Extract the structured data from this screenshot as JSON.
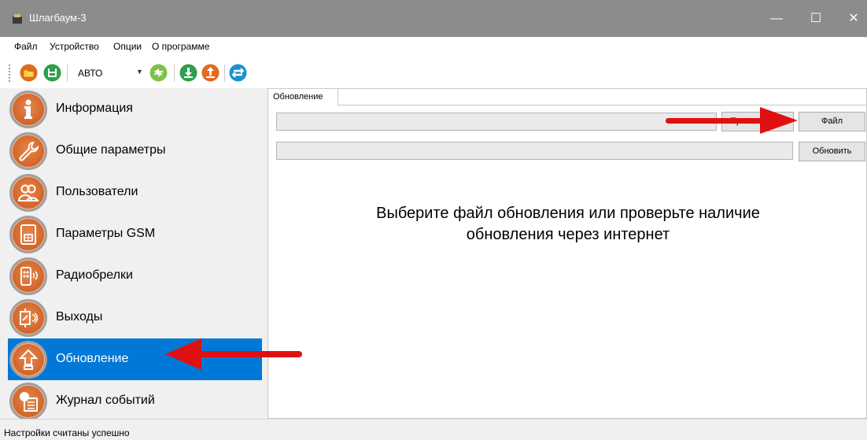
{
  "window": {
    "title": "Шлагбаум-3",
    "minimize": "—",
    "maximize": "☐",
    "close": "✕"
  },
  "menu": {
    "items": [
      "Файл",
      "Устройство",
      "Опции",
      "О программе"
    ]
  },
  "toolbar": {
    "mode_select": "АВТО",
    "buttons": [
      "open-folder-icon",
      "save-icon",
      "sync-icon",
      "download-icon",
      "upload-icon",
      "connection-icon"
    ]
  },
  "sidebar": {
    "items": [
      {
        "label": "Информация",
        "icon": "info-icon"
      },
      {
        "label": "Общие параметры",
        "icon": "wrench-icon"
      },
      {
        "label": "Пользователи",
        "icon": "users-icon"
      },
      {
        "label": "Параметры GSM",
        "icon": "sim-card-icon"
      },
      {
        "label": "Радиобрелки",
        "icon": "remote-fob-icon"
      },
      {
        "label": "Выходы",
        "icon": "relay-output-icon"
      },
      {
        "label": "Обновление",
        "icon": "update-arrow-icon",
        "active": true
      },
      {
        "label": "Журнал событий",
        "icon": "event-log-icon"
      }
    ]
  },
  "main": {
    "tab_label": "Обновление",
    "file_path_value": "",
    "update_path_value": "",
    "check_button_partial": "Пр",
    "file_button": "Файл",
    "update_button": "Обновить",
    "message_line1": "Выберите файл обновления или проверьте наличие",
    "message_line2": "обновления через интернет"
  },
  "status": {
    "text": "Настройки считаны успешно"
  },
  "colors": {
    "accent": "#0078d7",
    "icon_orange": "#d86a2e",
    "arrow_red": "#e01010",
    "titlebar": "#8c8c8c"
  }
}
